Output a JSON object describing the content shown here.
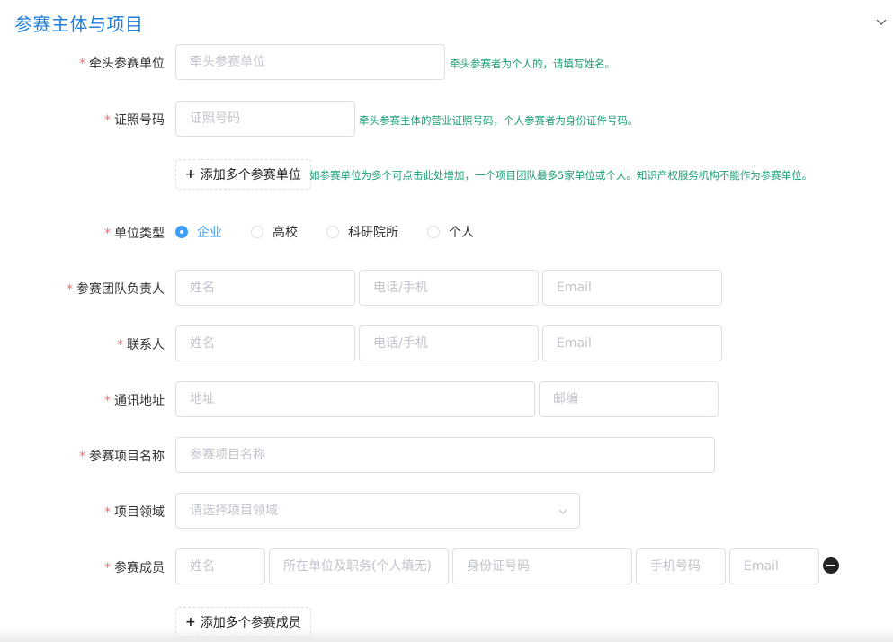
{
  "section": {
    "title": "参赛主体与项目",
    "collapse_icon": "chevron-down-icon"
  },
  "lead_org": {
    "label": "牵头参赛单位",
    "placeholder": "牵头参赛单位",
    "hint": "牵头参赛者为个人的，请填写姓名。"
  },
  "license": {
    "label": "证照号码",
    "placeholder": "证照号码",
    "hint": "牵头参赛主体的营业证照号码，个人参赛者为身份证件号码。"
  },
  "add_org": {
    "label": "+ 添加多个参赛单位",
    "plus": "+",
    "text": "添加多个参赛单位",
    "hint": "如参赛单位为多个可点击此处增加，一个项目团队最多5家单位或个人。知识产权服务机构不能作为参赛单位。"
  },
  "org_type": {
    "label": "单位类型",
    "options": [
      "企业",
      "高校",
      "科研院所",
      "个人"
    ],
    "selected": "企业"
  },
  "team_leader": {
    "label": "参赛团队负责人",
    "name_placeholder": "姓名",
    "phone_placeholder": "电话/手机",
    "email_placeholder": "Email"
  },
  "contact": {
    "label": "联系人",
    "name_placeholder": "姓名",
    "phone_placeholder": "电话/手机",
    "email_placeholder": "Email"
  },
  "address": {
    "label": "通讯地址",
    "address_placeholder": "地址",
    "zip_placeholder": "邮编"
  },
  "project_name": {
    "label": "参赛项目名称",
    "placeholder": "参赛项目名称"
  },
  "project_field": {
    "label": "项目领域",
    "placeholder": "请选择项目领域"
  },
  "members": {
    "label": "参赛成员",
    "name_placeholder": "姓名",
    "org_placeholder": "所在单位及职务(个人填无)",
    "id_placeholder": "身份证号码",
    "phone_placeholder": "手机号码",
    "email_placeholder": "Email",
    "remove_icon": "minus-circle-icon"
  },
  "add_member": {
    "plus": "+",
    "text": "添加多个参赛成员"
  },
  "required_mark": "*",
  "colors": {
    "title": "#1f7fd8",
    "accent": "#409eff",
    "hint": "#1a9e75",
    "required": "#f56c6c",
    "border": "#dcdfe6",
    "placeholder": "#c0c4cc"
  }
}
